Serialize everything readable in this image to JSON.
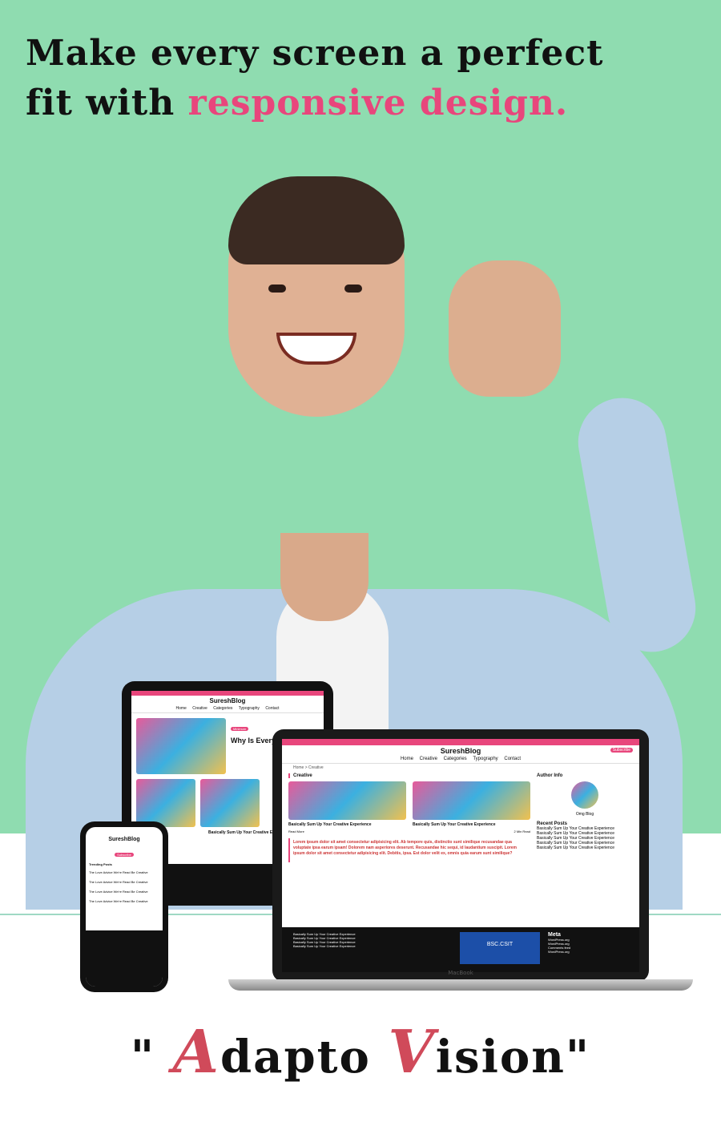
{
  "headline": {
    "line1": "Make every screen a perfect",
    "line2_prefix": "fit with ",
    "line2_accent": "responsive design."
  },
  "colors": {
    "background": "#8fdcb0",
    "accent": "#e8467c",
    "brand_caps": "#d04a5a"
  },
  "site": {
    "title": "SureshBlog",
    "nav": [
      "Home",
      "Creative",
      "Categories",
      "Typography",
      "Contact"
    ],
    "breadcrumb": "Home  >  Creative",
    "section_label": "Creative",
    "subscribe": "Subscribe",
    "tablet_badge": "Minimum",
    "tablet_headline": "Why Is Every About Mini",
    "post_title": "Basically Sum Up Your Creative Experience",
    "read_more": "Read More",
    "read_time": "2 Min Read",
    "quote": "Lorem ipsum dolor sit amet consectetur adipisicing elit. Ab tempore quis, distinctio sunt similique recusandae qua voluptate ipsa earum ipsam! Dolorem nam asperiores deserunt. Recusandae hic sequi, id laudantium suscipit. Lorem ipsum dolor sit amet consectetur adipisicing elit. Debitis, ipsa. Est dolor velit ex, omnis quia earum sunt similique?",
    "author_info": "Author Info",
    "author_name": "Omg Blog",
    "recent_posts": "Recent Posts",
    "recent_items": [
      "Basically Sum Up Your Creative Experience",
      "Basically Sum Up Your Creative Experience",
      "Basically Sum Up Your Creative Experience",
      "Basically Sum Up Your Creative Experience",
      "Basically Sum Up Your Creative Experience"
    ],
    "footer_links": [
      "Basically Sum Up Your Creative Experience",
      "Basically Sum Up Your Creative Experience",
      "Basically Sum Up Your Creative Experience",
      "Basically Sum Up Your Creative Experience"
    ],
    "video_title": "BSC.CSIT",
    "meta_title": "Meta",
    "meta_items": [
      "WordPress.org",
      "WordPress.org",
      "Comments feed",
      "WordPress.org"
    ],
    "phone_trending": "Trending Posts",
    "phone_items": [
      "The Love Advice We're Read Be Creative",
      "The Love Advice We're Read Be Creative",
      "The Love Advice We're Read Be Creative",
      "The Love Advice We're Read Be Creative"
    ]
  },
  "laptop_label": "MacBook",
  "brand": {
    "open_quote": "\"",
    "cap1": "A",
    "rest1": "dapto",
    "cap2": "V",
    "rest2": "ision",
    "close_quote": "\""
  }
}
